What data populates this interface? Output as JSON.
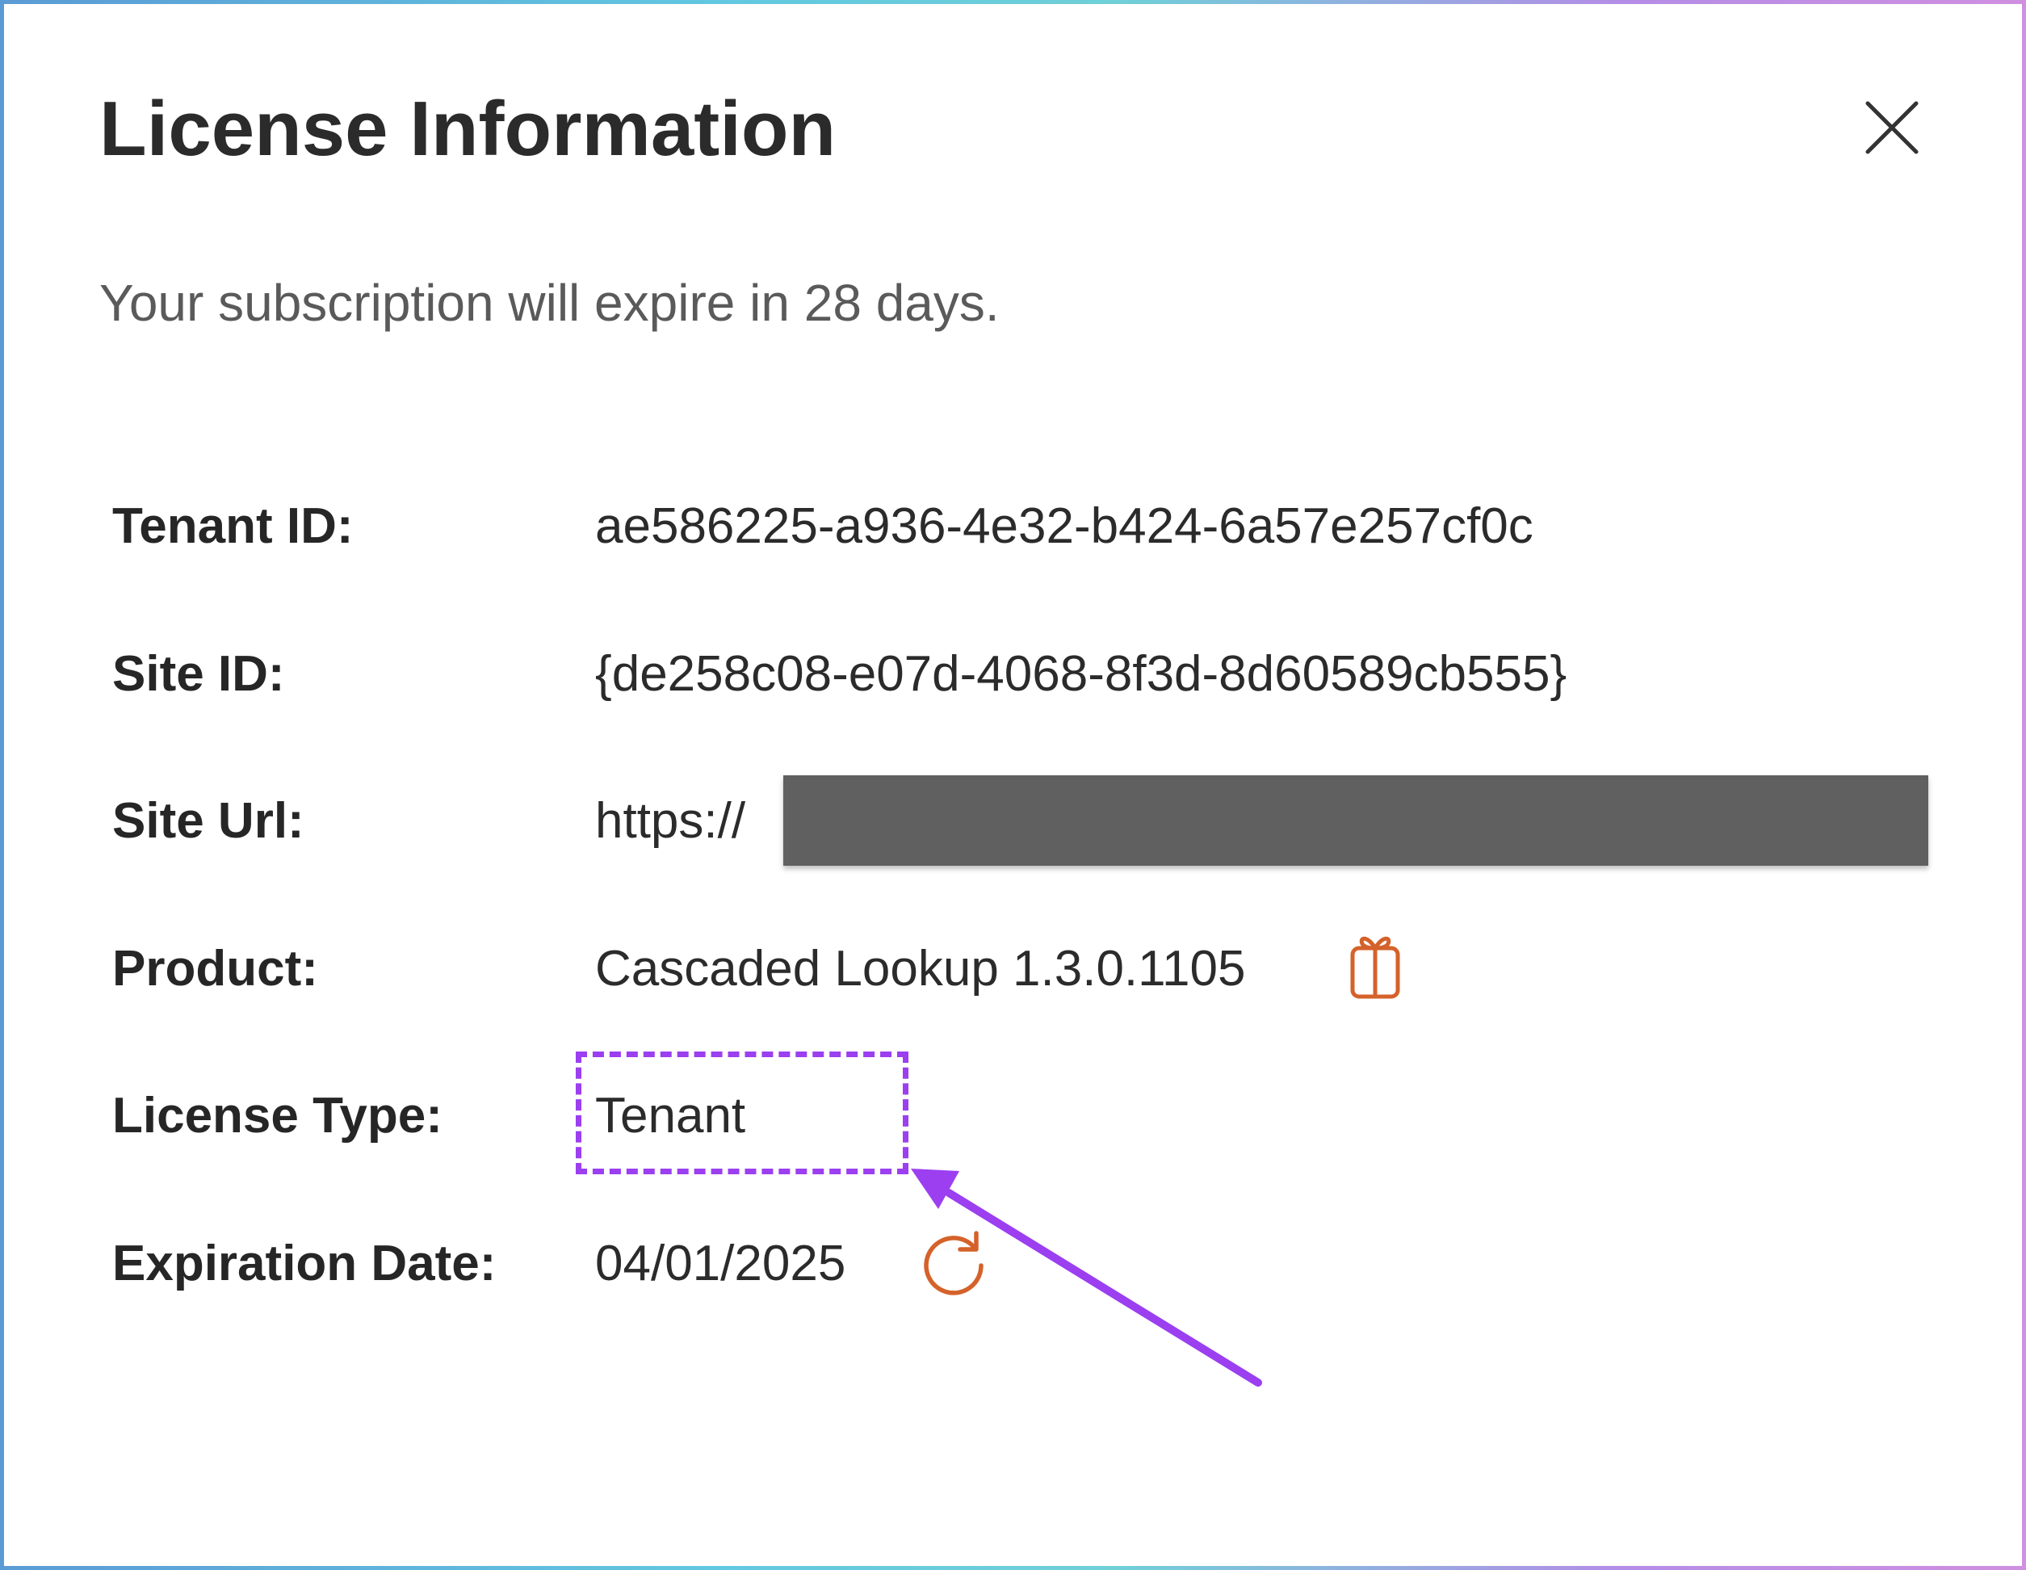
{
  "dialog": {
    "title": "License Information",
    "subtitle": "Your subscription will expire in 28 days.",
    "rows": [
      {
        "label": "Tenant ID:",
        "value": "ae586225-a936-4e32-b424-6a57e257cf0c"
      },
      {
        "label": "Site ID:",
        "value": "{de258c08-e07d-4068-8f3d-8d60589cb555}"
      },
      {
        "label": "Site Url:",
        "value": "https://"
      },
      {
        "label": "Product:",
        "value": "Cascaded Lookup 1.3.0.1105"
      },
      {
        "label": "License Type:",
        "value": "Tenant"
      },
      {
        "label": "Expiration Date:",
        "value": "04/01/2025"
      }
    ]
  },
  "icons": {
    "close": "close-icon",
    "product": "gift-icon",
    "expiration": "refresh-icon"
  },
  "colors": {
    "accent_icon": "#d4622a",
    "annotation": "#9b3ff0",
    "redaction": "#606060"
  }
}
